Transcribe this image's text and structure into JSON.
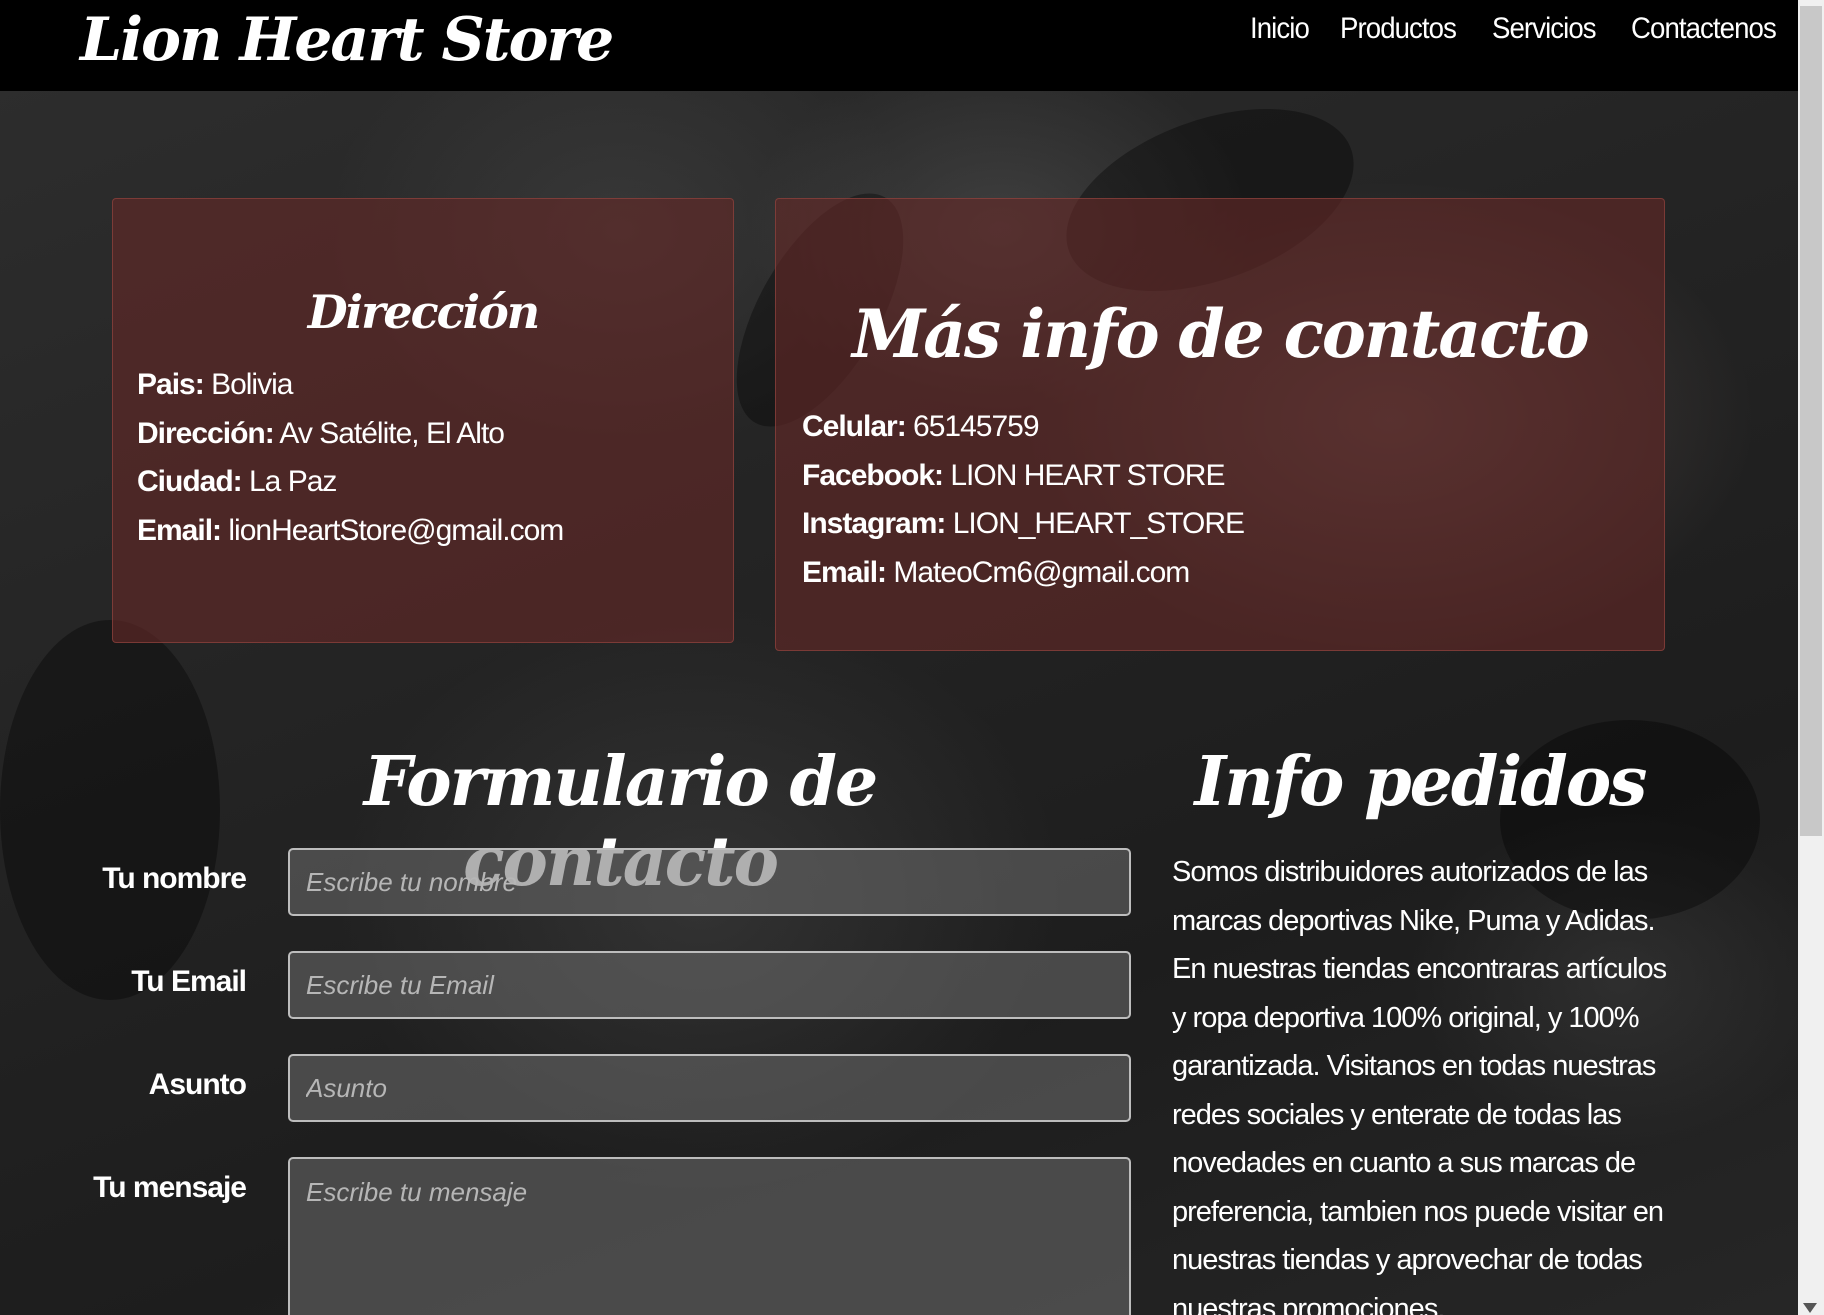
{
  "nav": {
    "brand": "Lion Heart Store",
    "links": [
      "Inicio",
      "Productos",
      "Servicios",
      "Contactenos"
    ]
  },
  "direccion": {
    "title": "Dirección",
    "rows": [
      {
        "label": "Pais:",
        "value": "Bolivia"
      },
      {
        "label": "Dirección:",
        "value": "Av Satélite, El Alto"
      },
      {
        "label": "Ciudad:",
        "value": "La Paz"
      },
      {
        "label": "Email:",
        "value": "lionHeartStore@gmail.com"
      }
    ]
  },
  "mas_info": {
    "title": "Más info de contacto",
    "rows": [
      {
        "label": "Celular:",
        "value": "65145759"
      },
      {
        "label": "Facebook:",
        "value": "LION HEART STORE"
      },
      {
        "label": "Instagram:",
        "value": "LION_HEART_STORE"
      },
      {
        "label": "Email:",
        "value": "MateoCm6@gmail.com"
      }
    ]
  },
  "form": {
    "title": "Formulario de contacto",
    "fields": [
      {
        "label": "Tu nombre",
        "placeholder": "Escribe tu nombre",
        "value": ""
      },
      {
        "label": "Tu Email",
        "placeholder": "Escribe tu Email",
        "value": ""
      },
      {
        "label": "Asunto",
        "placeholder": "Asunto",
        "value": ""
      },
      {
        "label": "Tu mensaje",
        "placeholder": "Escribe tu mensaje",
        "value": ""
      }
    ]
  },
  "pedidos": {
    "title": "Info pedidos",
    "text": "Somos distribuidores autorizados de las marcas deportivas Nike, Puma y Adidas. En nuestras tiendas encontraras artículos y ropa deportiva 100% original, y 100% garantizada. Visitanos en todas nuestras redes sociales y enterate de todas las novedades en cuanto a sus marcas de preferencia, tambien nos puede visitar en nuestras tiendas y aprovechar de todas nuestras promociones."
  },
  "colors": {
    "navbar": "#000000",
    "card": "#642826",
    "text": "#ffffff"
  },
  "icons": [
    "scroll-down-arrow-icon"
  ]
}
